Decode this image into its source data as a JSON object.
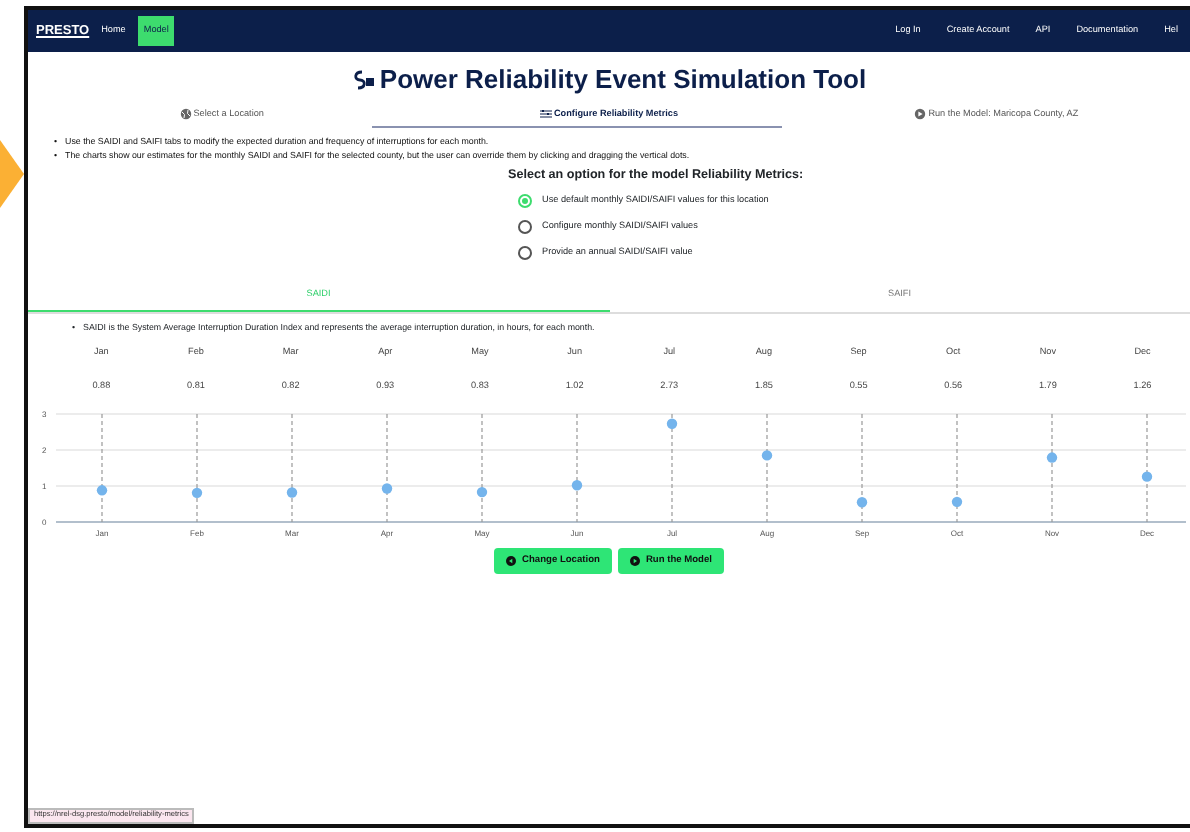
{
  "navbar": {
    "brand": "PRESTO",
    "links": [
      {
        "label": "Home",
        "selected": false
      },
      {
        "label": "Model",
        "selected": true
      }
    ],
    "right_links": [
      "Log In",
      "Create Account",
      "API",
      "Documentation",
      "Hel"
    ]
  },
  "title": "Power Reliability Event Simulation Tool",
  "steps": [
    {
      "kind": "location",
      "label": "Select a Location",
      "selected": false
    },
    {
      "kind": "metrics",
      "label": "Configure Reliability Metrics",
      "selected": true
    },
    {
      "kind": "run",
      "label": "Run the Model: Maricopa County, AZ",
      "selected": false
    }
  ],
  "bullet": "•",
  "instructions": [
    "Use the SAIDI and SAIFI tabs to modify the expected duration and frequency of interruptions for each month.",
    "The charts show our estimates for the monthly SAIDI and SAIFI for the selected county, but the user can override them by clicking and dragging the vertical dots."
  ],
  "options": {
    "heading": "Select an option for the model Reliability Metrics:",
    "items": [
      {
        "label": "Use default monthly SAIDI/SAIFI values for this location",
        "selected": true
      },
      {
        "label": "Configure monthly SAIDI/SAIFI values",
        "selected": false
      },
      {
        "label": "Provide an annual SAIDI/SAIFI value",
        "selected": false
      }
    ]
  },
  "tabs": [
    {
      "label": "SAIDI",
      "selected": true
    },
    {
      "label": "SAIFI",
      "selected": false
    }
  ],
  "description": "SAIDI is the System Average Interruption Duration Index and represents the average interruption duration, in hours, for each month.",
  "table": {
    "columns": [
      "Jan",
      "Feb",
      "Mar",
      "Apr",
      "May",
      "Jun",
      "Jul",
      "Aug",
      "Sep",
      "Oct",
      "Nov",
      "Dec"
    ],
    "values": [
      "0.88",
      "0.81",
      "0.82",
      "0.93",
      "0.83",
      "1.02",
      "2.73",
      "1.85",
      "0.55",
      "0.56",
      "1.79",
      "1.26"
    ]
  },
  "chart_data": {
    "type": "scatter",
    "categories": [
      "Jan",
      "Feb",
      "Mar",
      "Apr",
      "May",
      "Jun",
      "Jul",
      "Aug",
      "Sep",
      "Oct",
      "Nov",
      "Dec"
    ],
    "series": [
      {
        "color": "#74b4ec",
        "values": [
          0.88,
          0.81,
          0.82,
          0.93,
          0.83,
          1.02,
          2.73,
          1.85,
          0.55,
          0.56,
          1.79,
          1.26
        ]
      }
    ],
    "ylim": [
      0,
      3
    ],
    "yticks": [
      0,
      1,
      2,
      3
    ],
    "grid": true
  },
  "buttons": [
    {
      "kind": "back",
      "label": "Change Location"
    },
    {
      "kind": "run",
      "label": "Run the Model"
    }
  ],
  "status_bar": "https://nrel-dsg.presto/model/reliability-metrics"
}
